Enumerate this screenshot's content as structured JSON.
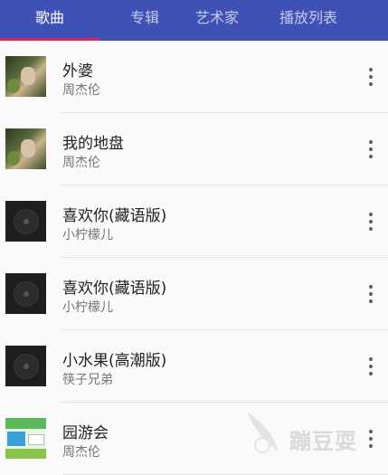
{
  "tabs": [
    {
      "label": "歌曲",
      "active": true
    },
    {
      "label": "专辑",
      "active": false
    },
    {
      "label": "艺术家",
      "active": false
    },
    {
      "label": "播放列表",
      "active": false
    }
  ],
  "colors": {
    "toolbar": "#3f51b5",
    "indicator": "#e91e63"
  },
  "songs": [
    {
      "title": "外婆",
      "artist": "周杰伦",
      "cover": "photo-album-cover"
    },
    {
      "title": "我的地盘",
      "artist": "周杰伦",
      "cover": "photo-album-cover"
    },
    {
      "title": "喜欢你(藏语版)",
      "artist": "小柠檬儿",
      "cover": "disc-placeholder-icon"
    },
    {
      "title": "喜欢你(藏语版)",
      "artist": "小柠檬儿",
      "cover": "disc-placeholder-icon"
    },
    {
      "title": "小水果(高潮版)",
      "artist": "筷子兄弟",
      "cover": "disc-placeholder-icon"
    },
    {
      "title": "园游会",
      "artist": "周杰伦",
      "cover": "green-album-cover"
    }
  ],
  "watermark": {
    "text": "蹦豆耍"
  }
}
